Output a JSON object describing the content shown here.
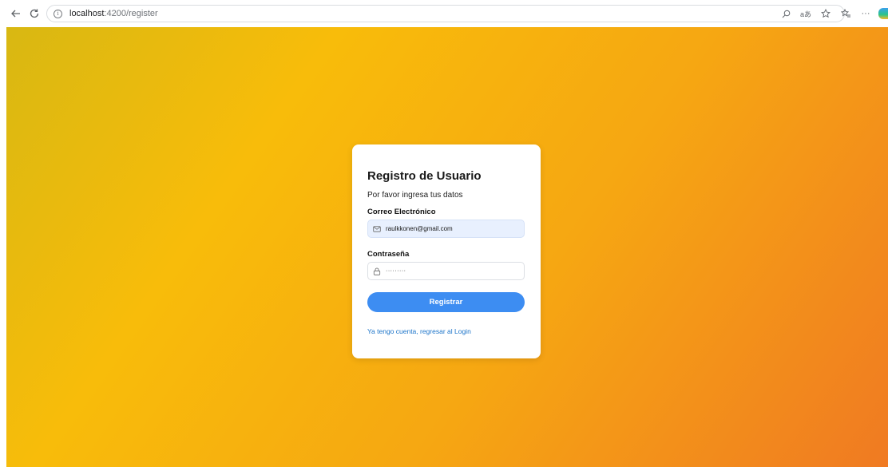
{
  "browser": {
    "url_host": "localhost",
    "url_path": ":4200/register"
  },
  "register_card": {
    "title": "Registro de Usuario",
    "subtitle": "Por favor ingresa tus datos",
    "email_label": "Correo Electrónico",
    "email_value": "raulkkonen@gmail.com",
    "password_label": "Contraseña",
    "password_value": "·········",
    "submit_label": "Registrar",
    "login_link": "Ya tengo cuenta, regresar al Login"
  },
  "colors": {
    "accent": "#3d8df2",
    "link": "#1a73c9",
    "gradient_start": "#d8b812",
    "gradient_end": "#f07a22"
  },
  "icons": {
    "email": "envelope-icon",
    "password": "lock-icon"
  }
}
